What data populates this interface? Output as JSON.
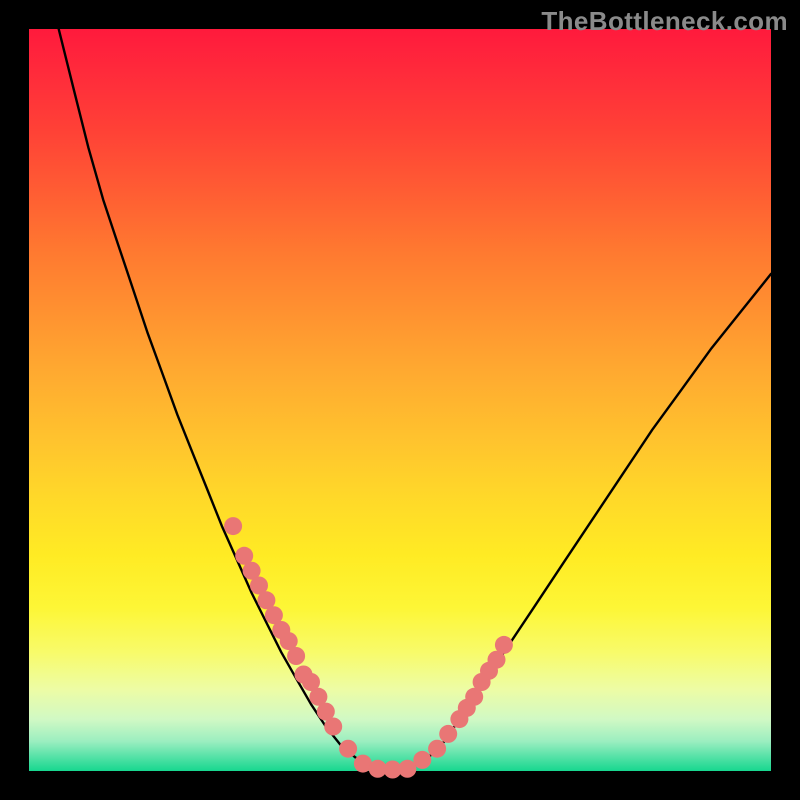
{
  "watermark": "TheBottleneck.com",
  "colors": {
    "background": "#000000",
    "gradient_top": "#ff1a3c",
    "gradient_bottom": "#17d78f",
    "curve_stroke": "#000000",
    "dot_fill": "#e97675"
  },
  "chart_data": {
    "type": "line",
    "title": "",
    "xlabel": "",
    "ylabel": "",
    "xlim": [
      0,
      100
    ],
    "ylim": [
      0,
      100
    ],
    "grid": false,
    "series": [
      {
        "name": "bottleneck-curve",
        "x": [
          4,
          6,
          8,
          10,
          12,
          14,
          16,
          18,
          20,
          22,
          24,
          26,
          28,
          30,
          32,
          34,
          36,
          38,
          40,
          42,
          44,
          46,
          48,
          50,
          52,
          54,
          56,
          58,
          60,
          64,
          68,
          72,
          76,
          80,
          84,
          88,
          92,
          96,
          100
        ],
        "y": [
          100,
          92,
          84,
          77,
          71,
          65,
          59,
          53.5,
          48,
          43,
          38,
          33,
          28.5,
          24,
          20,
          16,
          12.5,
          9,
          6,
          3.5,
          1.8,
          0.7,
          0.2,
          0.2,
          0.8,
          2,
          4,
          7,
          10,
          16,
          22,
          28,
          34,
          40,
          46,
          51.5,
          57,
          62,
          67
        ]
      },
      {
        "name": "highlight-dots",
        "x": [
          27.5,
          29,
          30,
          31,
          32,
          33,
          34,
          35,
          36,
          37,
          38,
          39,
          40,
          41,
          43,
          45,
          47,
          49,
          51,
          53,
          55,
          56.5,
          58,
          59,
          60,
          61,
          62,
          63,
          64
        ],
        "y": [
          33,
          29,
          27,
          25,
          23,
          21,
          19,
          17.5,
          15.5,
          13,
          12,
          10,
          8,
          6,
          3,
          1,
          0.3,
          0.2,
          0.3,
          1.5,
          3,
          5,
          7,
          8.5,
          10,
          12,
          13.5,
          15,
          17
        ]
      }
    ]
  }
}
